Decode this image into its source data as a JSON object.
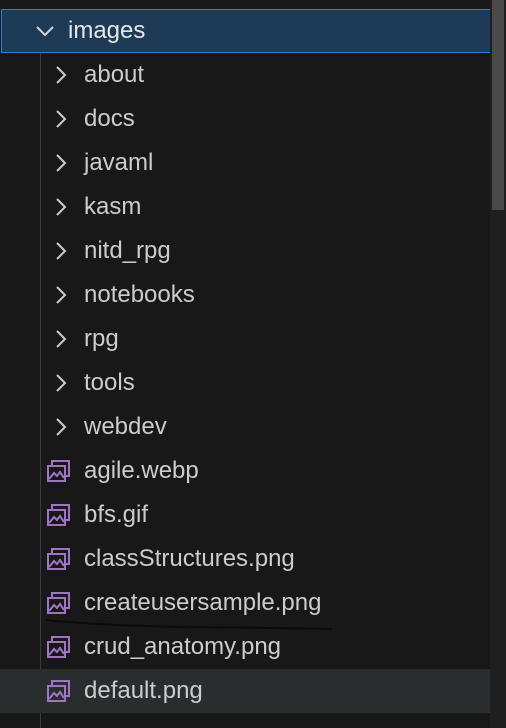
{
  "explorer": {
    "root": {
      "label": "images",
      "icon": "chevron-down-icon",
      "expanded": true
    },
    "folders": [
      {
        "label": "about",
        "icon": "chevron-right-icon"
      },
      {
        "label": "docs",
        "icon": "chevron-right-icon"
      },
      {
        "label": "javaml",
        "icon": "chevron-right-icon"
      },
      {
        "label": "kasm",
        "icon": "chevron-right-icon"
      },
      {
        "label": "nitd_rpg",
        "icon": "chevron-right-icon"
      },
      {
        "label": "notebooks",
        "icon": "chevron-right-icon"
      },
      {
        "label": "rpg",
        "icon": "chevron-right-icon"
      },
      {
        "label": "tools",
        "icon": "chevron-right-icon"
      },
      {
        "label": "webdev",
        "icon": "chevron-right-icon"
      }
    ],
    "files": [
      {
        "label": "agile.webp",
        "icon": "image-file-icon"
      },
      {
        "label": "bfs.gif",
        "icon": "image-file-icon"
      },
      {
        "label": "classStructures.png",
        "icon": "image-file-icon"
      },
      {
        "label": "createusersample.png",
        "icon": "image-file-icon"
      },
      {
        "label": "crud_anatomy.png",
        "icon": "image-file-icon"
      },
      {
        "label": "default.png",
        "icon": "image-file-icon"
      }
    ]
  },
  "colors": {
    "background": "#181818",
    "selection_bg": "#1d3b57",
    "selection_border": "#2f7bd6",
    "text": "#cccccc",
    "image_icon": "#a074c4"
  }
}
